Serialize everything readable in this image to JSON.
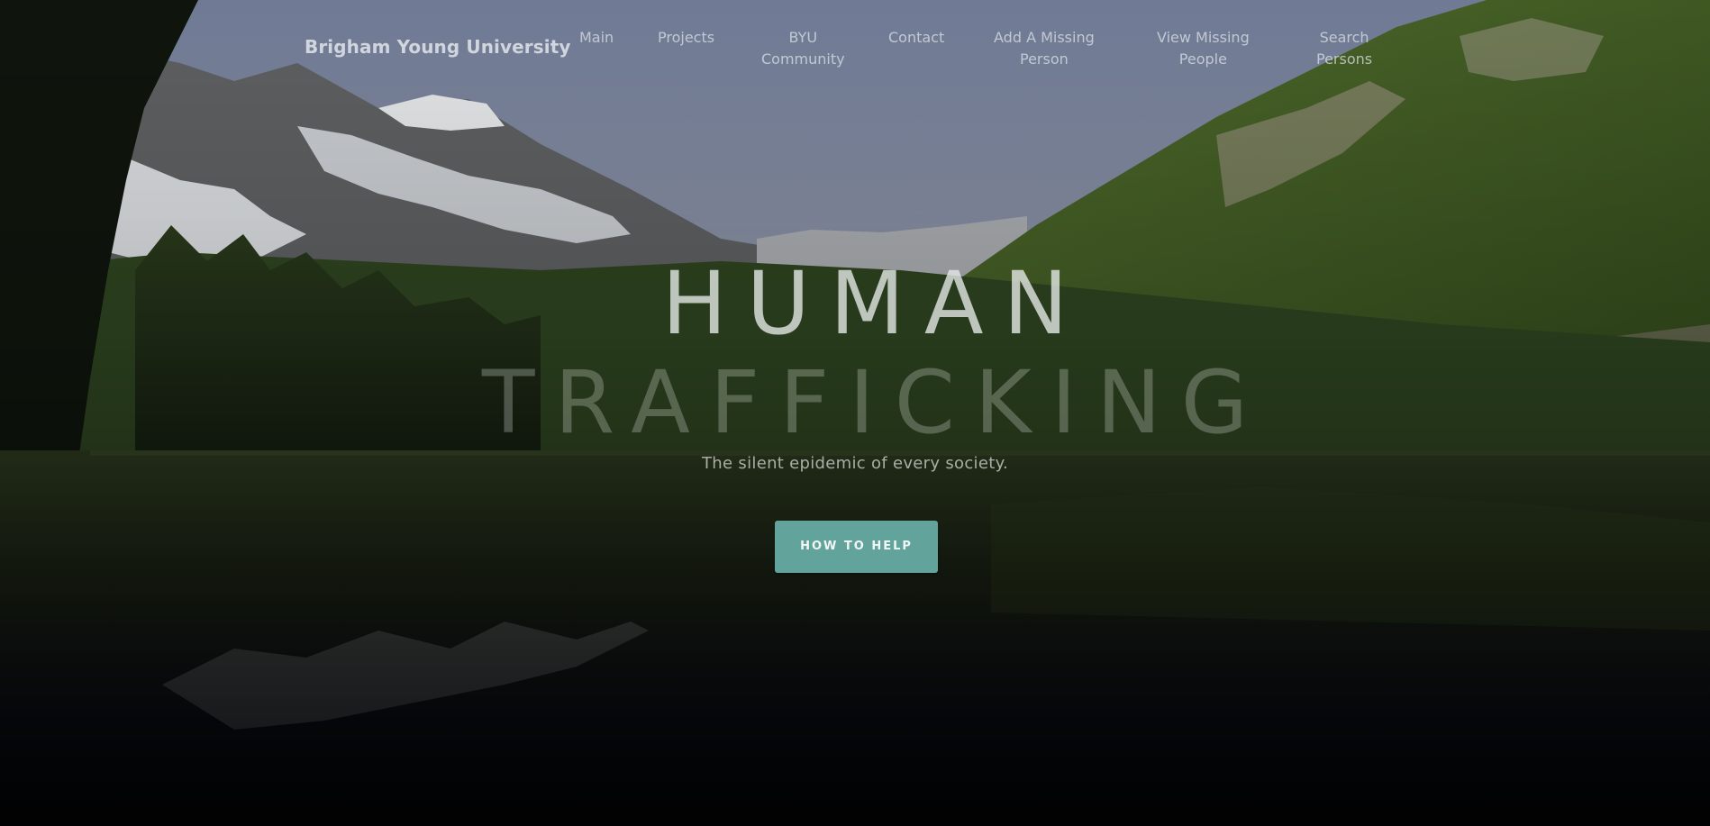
{
  "navbar": {
    "brand": "Brigham Young University",
    "items": [
      {
        "line1": "Main",
        "line2": ""
      },
      {
        "line1": "Projects",
        "line2": ""
      },
      {
        "line1": "BYU",
        "line2": "Community"
      },
      {
        "line1": "Contact",
        "line2": ""
      },
      {
        "line1": "Add A Missing",
        "line2": "Person"
      },
      {
        "line1": "View Missing",
        "line2": "People"
      },
      {
        "line1": "Search",
        "line2": "Persons"
      }
    ]
  },
  "hero": {
    "title_line_1": "HUMAN",
    "title_line_2": "TRAFFICKING",
    "subtitle": "The silent epidemic of every society.",
    "cta_label": "HOW TO HELP"
  },
  "colors": {
    "accent": "#62a39c",
    "sky": "#7f8aa3",
    "forest": "#3d5a24",
    "water": "#10141c"
  }
}
